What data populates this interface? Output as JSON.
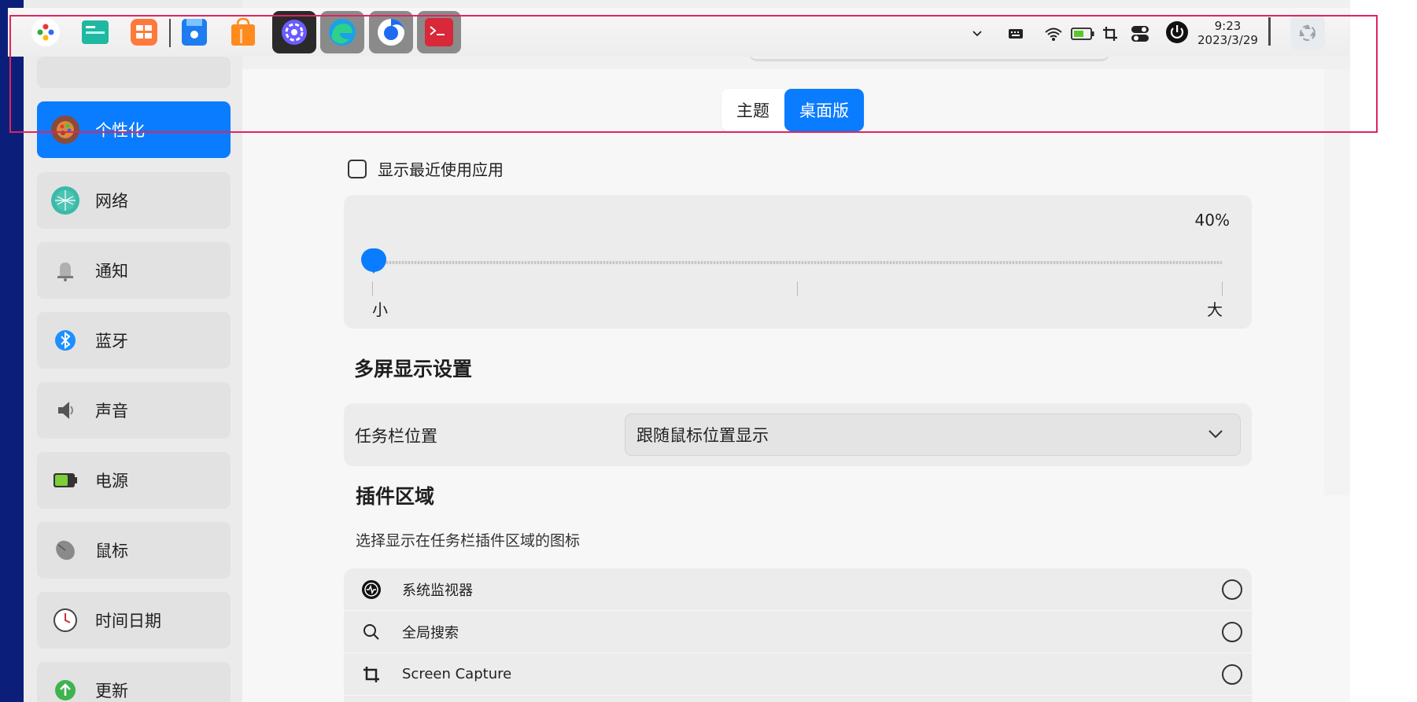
{
  "sidebar": {
    "items": [
      {
        "label": "个性化",
        "icon": "palette-icon"
      },
      {
        "label": "网络",
        "icon": "network-icon"
      },
      {
        "label": "通知",
        "icon": "bell-icon"
      },
      {
        "label": "蓝牙",
        "icon": "bluetooth-icon"
      },
      {
        "label": "声音",
        "icon": "speaker-icon"
      },
      {
        "label": "电源",
        "icon": "battery-icon"
      },
      {
        "label": "鼠标",
        "icon": "mouse-icon"
      },
      {
        "label": "时间日期",
        "icon": "clock-icon"
      },
      {
        "label": "更新",
        "icon": "update-icon"
      }
    ]
  },
  "tabs": {
    "theme": "主题",
    "desktop": "桌面版"
  },
  "recent_apps": {
    "label": "显示最近使用应用",
    "checked": false
  },
  "size_slider": {
    "value_text": "40%",
    "value": 0.0,
    "min_label": "小",
    "max_label": "大"
  },
  "multi_screen": {
    "title": "多屏显示设置",
    "taskbar_position_label": "任务栏位置",
    "taskbar_position_value": "跟随鼠标位置显示"
  },
  "plugin_area": {
    "title": "插件区域",
    "description": "选择显示在任务栏插件区域的图标",
    "items": [
      {
        "label": "系统监视器",
        "icon": "system-monitor-icon"
      },
      {
        "label": "全局搜索",
        "icon": "search-icon"
      },
      {
        "label": "Screen Capture",
        "icon": "crop-icon"
      }
    ]
  },
  "taskbar": {
    "time": "9:23",
    "date": "2023/3/29"
  },
  "colors": {
    "accent": "#0a7cff",
    "highlight_box": "#e0245e",
    "left_strip": "#0b1f7a"
  }
}
